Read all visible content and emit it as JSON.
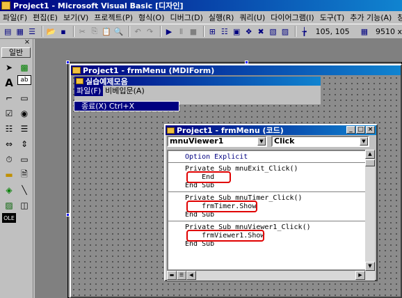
{
  "app": {
    "title": "Project1 - Microsoft Visual Basic [디자인]"
  },
  "menu": [
    "파일(F)",
    "편집(E)",
    "보기(V)",
    "프로젝트(P)",
    "형식(O)",
    "디버그(D)",
    "실행(R)",
    "쿼리(U)",
    "다이어그램(I)",
    "도구(T)",
    "추가 기능(A)",
    "창(W)",
    "도"
  ],
  "toolbar": {
    "coords": "105, 105",
    "size": "9510 x"
  },
  "toolbox": {
    "tab_label": "일반",
    "close": "×"
  },
  "mdi_form": {
    "title": "Project1 - frmMenu (MDIForm)"
  },
  "child_form": {
    "title": "실습예제모음",
    "menu": [
      "파일(F)",
      "비베입문(A)"
    ],
    "dropdown_item": "종료(X)   Ctrl+X"
  },
  "code_window": {
    "title": "Project1 - frmMenu (코드)",
    "object_combo": "mnuViewer1",
    "proc_combo": "Click",
    "lines": [
      "Option Explicit",
      "Private Sub mnuExit_Click()",
      "    End",
      "End Sub",
      "Private Sub mnuTimer_Click()",
      "    frmTimer.Show",
      "End Sub",
      "Private Sub mnuViewer1_Click()",
      "    frmViewer1.Show",
      "End Sub"
    ]
  },
  "colors": {
    "titlebar": "#000080",
    "highlight": "#e00000",
    "face": "#c0c0c0"
  }
}
